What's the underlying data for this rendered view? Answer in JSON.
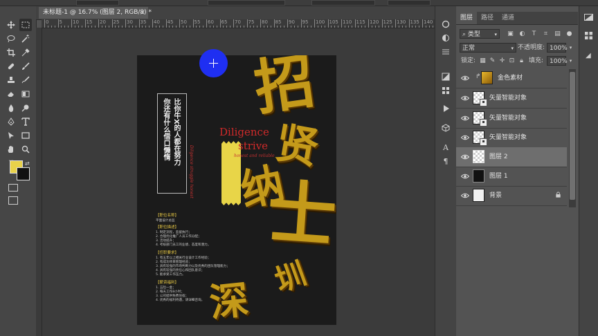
{
  "document": {
    "tab_title": "未标题-1 @ 16.7% (图层 2, RGB/8) *",
    "close_glyph": "×"
  },
  "ruler": {
    "numbers": [
      "0",
      "5",
      "10",
      "15",
      "20",
      "25",
      "30",
      "35",
      "40",
      "45",
      "50",
      "55",
      "60",
      "65",
      "70",
      "75",
      "80",
      "85",
      "90",
      "95",
      "100",
      "105",
      "110",
      "115",
      "120",
      "125",
      "130",
      "135",
      "140",
      "145"
    ]
  },
  "poster": {
    "vertical_columns": [
      "比你牛X的人都在努力",
      "你还有什么借口懒惰"
    ],
    "en_line1": "Diligence",
    "en_line2": "strive",
    "tagline": "honest and reliable",
    "vertical_red_en": "Diligence struggle honest",
    "gold_chars": [
      "招",
      "贤",
      "纳",
      "士",
      "深",
      "圳"
    ],
    "sections": [
      {
        "title": "【职位名称】",
        "lines": [
          "平面设计总监"
        ]
      },
      {
        "title": "【职位描述】",
        "lines": [
          "1. 制定流程，监督执行；",
          "2. 合理优化推广人员工作分配；",
          "3. 活动提升；",
          "4. 考核部门员工的业绩、态度和潜力。"
        ]
      },
      {
        "title": "【任职要求】",
        "lines": [
          "1. 有五年以上相关行业设计工作经验；",
          "2. 有成功项目管理经验；",
          "3. 具有较强的市场判断力以及优秀的团队管理能力；",
          "4. 具有较强的责任心和团队意识；",
          "5. 能承受工作压力。"
        ]
      },
      {
        "title": "【薪资福利】",
        "lines": [
          "1. 五险一金；",
          "2. 每天工作8小时；",
          "3. 公司提供免费住宿；",
          "4. 优秀的福利待遇，请详细咨询。"
        ]
      }
    ]
  },
  "layers_panel": {
    "tabs": [
      "图层",
      "路径",
      "通道"
    ],
    "filter_kind": "类型",
    "blend_mode": "正常",
    "opacity_label": "不透明度:",
    "opacity_value": "100%",
    "lock_label": "锁定:",
    "fill_label": "填充:",
    "fill_value": "100%",
    "layers": [
      {
        "name": "金色素材",
        "thumb": "gold",
        "selected": false,
        "smart": false,
        "locked": false,
        "clip": true
      },
      {
        "name": "矢量智能对象",
        "thumb": "check",
        "selected": false,
        "smart": true,
        "locked": false,
        "clip": false
      },
      {
        "name": "矢量智能对象",
        "thumb": "check",
        "selected": false,
        "smart": true,
        "locked": false,
        "clip": false
      },
      {
        "name": "矢量智能对象",
        "thumb": "check",
        "selected": false,
        "smart": true,
        "locked": false,
        "clip": false
      },
      {
        "name": "图层 2",
        "thumb": "check",
        "selected": true,
        "smart": false,
        "locked": false,
        "clip": false
      },
      {
        "name": "图层 1",
        "thumb": "black",
        "selected": false,
        "smart": false,
        "locked": false,
        "clip": false
      },
      {
        "name": "背景",
        "thumb": "white",
        "selected": false,
        "smart": false,
        "locked": true,
        "clip": false
      }
    ]
  },
  "colors": {
    "foreground": "#e8d24a",
    "background": "#111111",
    "marker": "#1f2ff2",
    "gold": "#c49a1a"
  },
  "icons": {
    "toolbar": [
      "move-icon",
      "marquee-icon",
      "lasso-icon",
      "magic-wand-icon",
      "crop-icon",
      "eyedropper-icon",
      "healing-icon",
      "brush-icon",
      "stamp-icon",
      "history-brush-icon",
      "eraser-icon",
      "gradient-icon",
      "blur-icon",
      "dodge-icon",
      "pen-icon",
      "type-icon",
      "path-select-icon",
      "rectangle-icon",
      "hand-icon",
      "zoom-icon"
    ],
    "strip": [
      "creative-cloud-icon",
      "learn-icon",
      "properties-icon",
      "adjustments-icon",
      "swatches-icon",
      "play-icon",
      "cube-icon",
      "text-icon",
      "paragraph-icon"
    ]
  }
}
